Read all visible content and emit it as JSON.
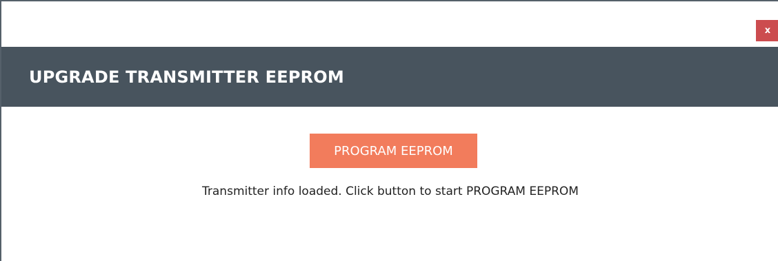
{
  "window": {
    "close_label": "x"
  },
  "header": {
    "title": "UPGRADE TRANSMITTER EEPROM"
  },
  "main": {
    "program_button_label": "PROGRAM EEPROM",
    "status_message": "Transmitter info loaded. Click button to start PROGRAM EEPROM"
  },
  "colors": {
    "header_background": "#48545e",
    "accent_button": "#f27c5c",
    "close_button": "#cc4c4f"
  }
}
